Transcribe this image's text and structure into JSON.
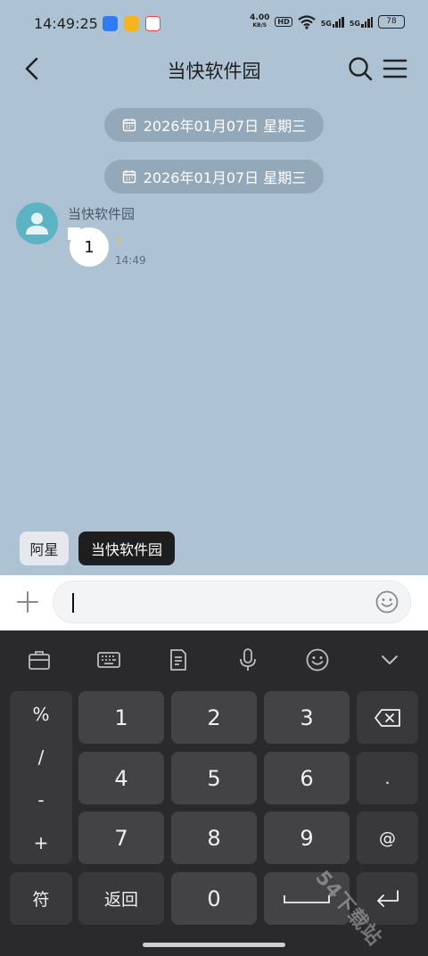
{
  "status_bar": {
    "time": "14:49:25",
    "net_speed_value": "4.00",
    "net_speed_unit": "KB/S",
    "hd_label": "HD",
    "signal1": "5G",
    "signal2": "5G",
    "battery": "78"
  },
  "header": {
    "title": "当快软件园"
  },
  "chat": {
    "date_separators": [
      "2026年01月07日 星期三",
      "2026年01月07日 星期三"
    ],
    "message": {
      "sender": "当快软件园",
      "text": "1",
      "read_count": "1",
      "time": "14:49"
    }
  },
  "quick_chips": [
    "阿星",
    "当快软件园"
  ],
  "input": {
    "value": ""
  },
  "keyboard": {
    "symbols": [
      "%",
      "/",
      "-",
      "+"
    ],
    "digits": [
      "1",
      "2",
      "3",
      "4",
      "5",
      "6",
      "7",
      "8",
      "9",
      "0"
    ],
    "dot": ".",
    "at": "@",
    "symbol_key": "符",
    "back_key": "返回"
  },
  "watermark": "54下载站",
  "colors": {
    "chat_bg": "#adc2d3",
    "avatar": "#5bb3c3",
    "keyboard_bg": "#2a2a2c",
    "key_bg": "#434345",
    "chip_active": "#1e1e1e"
  }
}
